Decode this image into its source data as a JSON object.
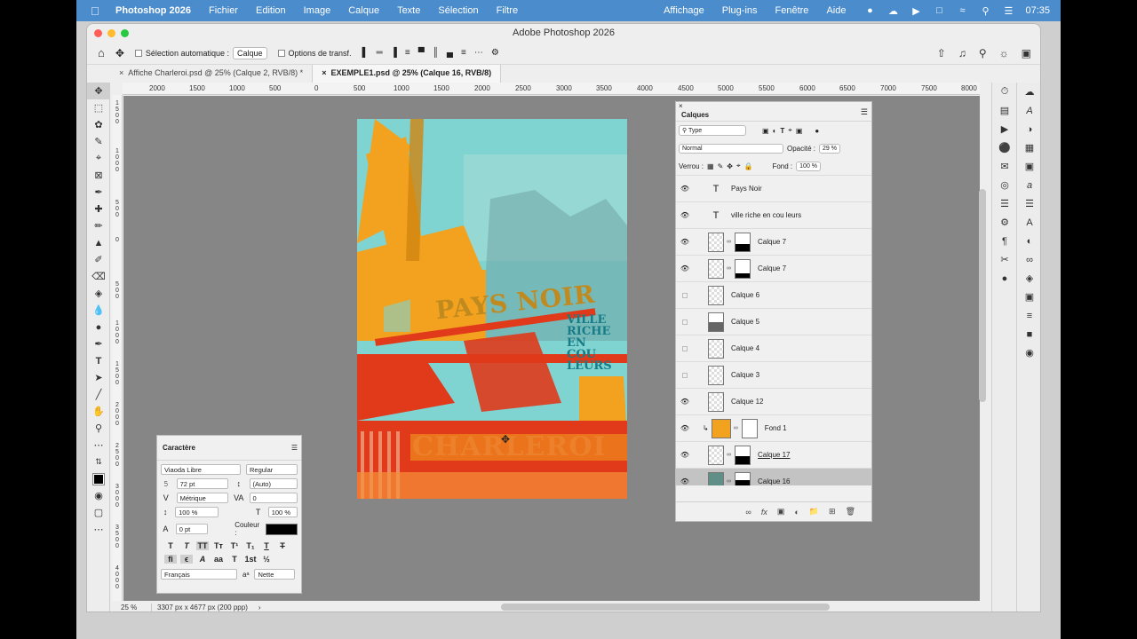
{
  "menubar": {
    "app_name": "Photoshop 2026",
    "items": [
      "Fichier",
      "Edition",
      "Image",
      "Calque",
      "Texte",
      "Sélection",
      "Filtre"
    ],
    "right_items": [
      "Affichage",
      "Plug-ins",
      "Fenêtre",
      "Aide"
    ],
    "clock": "07:35"
  },
  "window": {
    "title": "Adobe Photoshop 2026"
  },
  "options": {
    "auto_select_label": "Sélection automatique :",
    "auto_select_value": "Calque",
    "transform_label": "Options de transf."
  },
  "tabs": [
    {
      "label": "Affiche Charleroi.psd @ 25% (Calque 2, RVB/8) *"
    },
    {
      "label": "EXEMPLE1.psd @ 25% (Calque 16, RVB/8)"
    }
  ],
  "ruler": {
    "h_labels": [
      "2000",
      "1500",
      "1000",
      "500",
      "0",
      "500",
      "1000",
      "1500",
      "2000",
      "2500",
      "3000",
      "3500",
      "4000",
      "4500",
      "5000",
      "5500",
      "6000",
      "6500",
      "7000",
      "7500",
      "8000"
    ]
  },
  "poster": {
    "line1": "PAYS NOIR",
    "line2": [
      "VILLE",
      "RICHE",
      "EN",
      "COU",
      "LEURS"
    ],
    "line3": "CHARLEROI"
  },
  "status": {
    "zoom": "25 %",
    "dimensions": "3307 px x 4677 px (200 ppp)"
  },
  "layers_panel": {
    "title": "Calques",
    "filter": "Type",
    "blend_mode": "Normal",
    "opacity_label": "Opacité :",
    "opacity_value": "29 %",
    "lock_label": "Verrou :",
    "fill_label": "Fond :",
    "fill_value": "100 %",
    "layers": [
      {
        "name": "Pays Noir",
        "kind": "text",
        "visible": true
      },
      {
        "name": "ville  riche  en  cou leurs",
        "kind": "text",
        "visible": true
      },
      {
        "name": "Calque 7",
        "kind": "mask",
        "visible": true
      },
      {
        "name": "Calque 7",
        "kind": "mask",
        "visible": true
      },
      {
        "name": "Calque 6",
        "kind": "plain",
        "visible": false
      },
      {
        "name": "Calque 5",
        "kind": "plain",
        "visible": false
      },
      {
        "name": "Calque 4",
        "kind": "plain",
        "visible": false
      },
      {
        "name": "Calque 3",
        "kind": "plain",
        "visible": false
      },
      {
        "name": "Calque 12",
        "kind": "plain",
        "visible": true
      },
      {
        "name": "Fond 1",
        "kind": "fill",
        "visible": true
      },
      {
        "name": "Calque 17",
        "kind": "mask",
        "visible": true
      },
      {
        "name": "Calque 16",
        "kind": "mask",
        "visible": true
      }
    ]
  },
  "character_panel": {
    "title": "Caractère",
    "font_family": "Viaoda Libre",
    "font_style": "Regular",
    "size": "72 pt",
    "leading": "(Auto)",
    "kerning": "Métrique",
    "tracking": "0",
    "vscale": "100 %",
    "hscale": "100 %",
    "baseline": "0 pt",
    "color_label": "Couleur :",
    "language": "Français",
    "aa": "Nette"
  },
  "colors": {
    "menubar": "#4a8ccc",
    "poster_bg": "#7fd3d1",
    "orange": "#f2a21e",
    "red": "#e03a1a",
    "teal_text": "#167c86"
  }
}
